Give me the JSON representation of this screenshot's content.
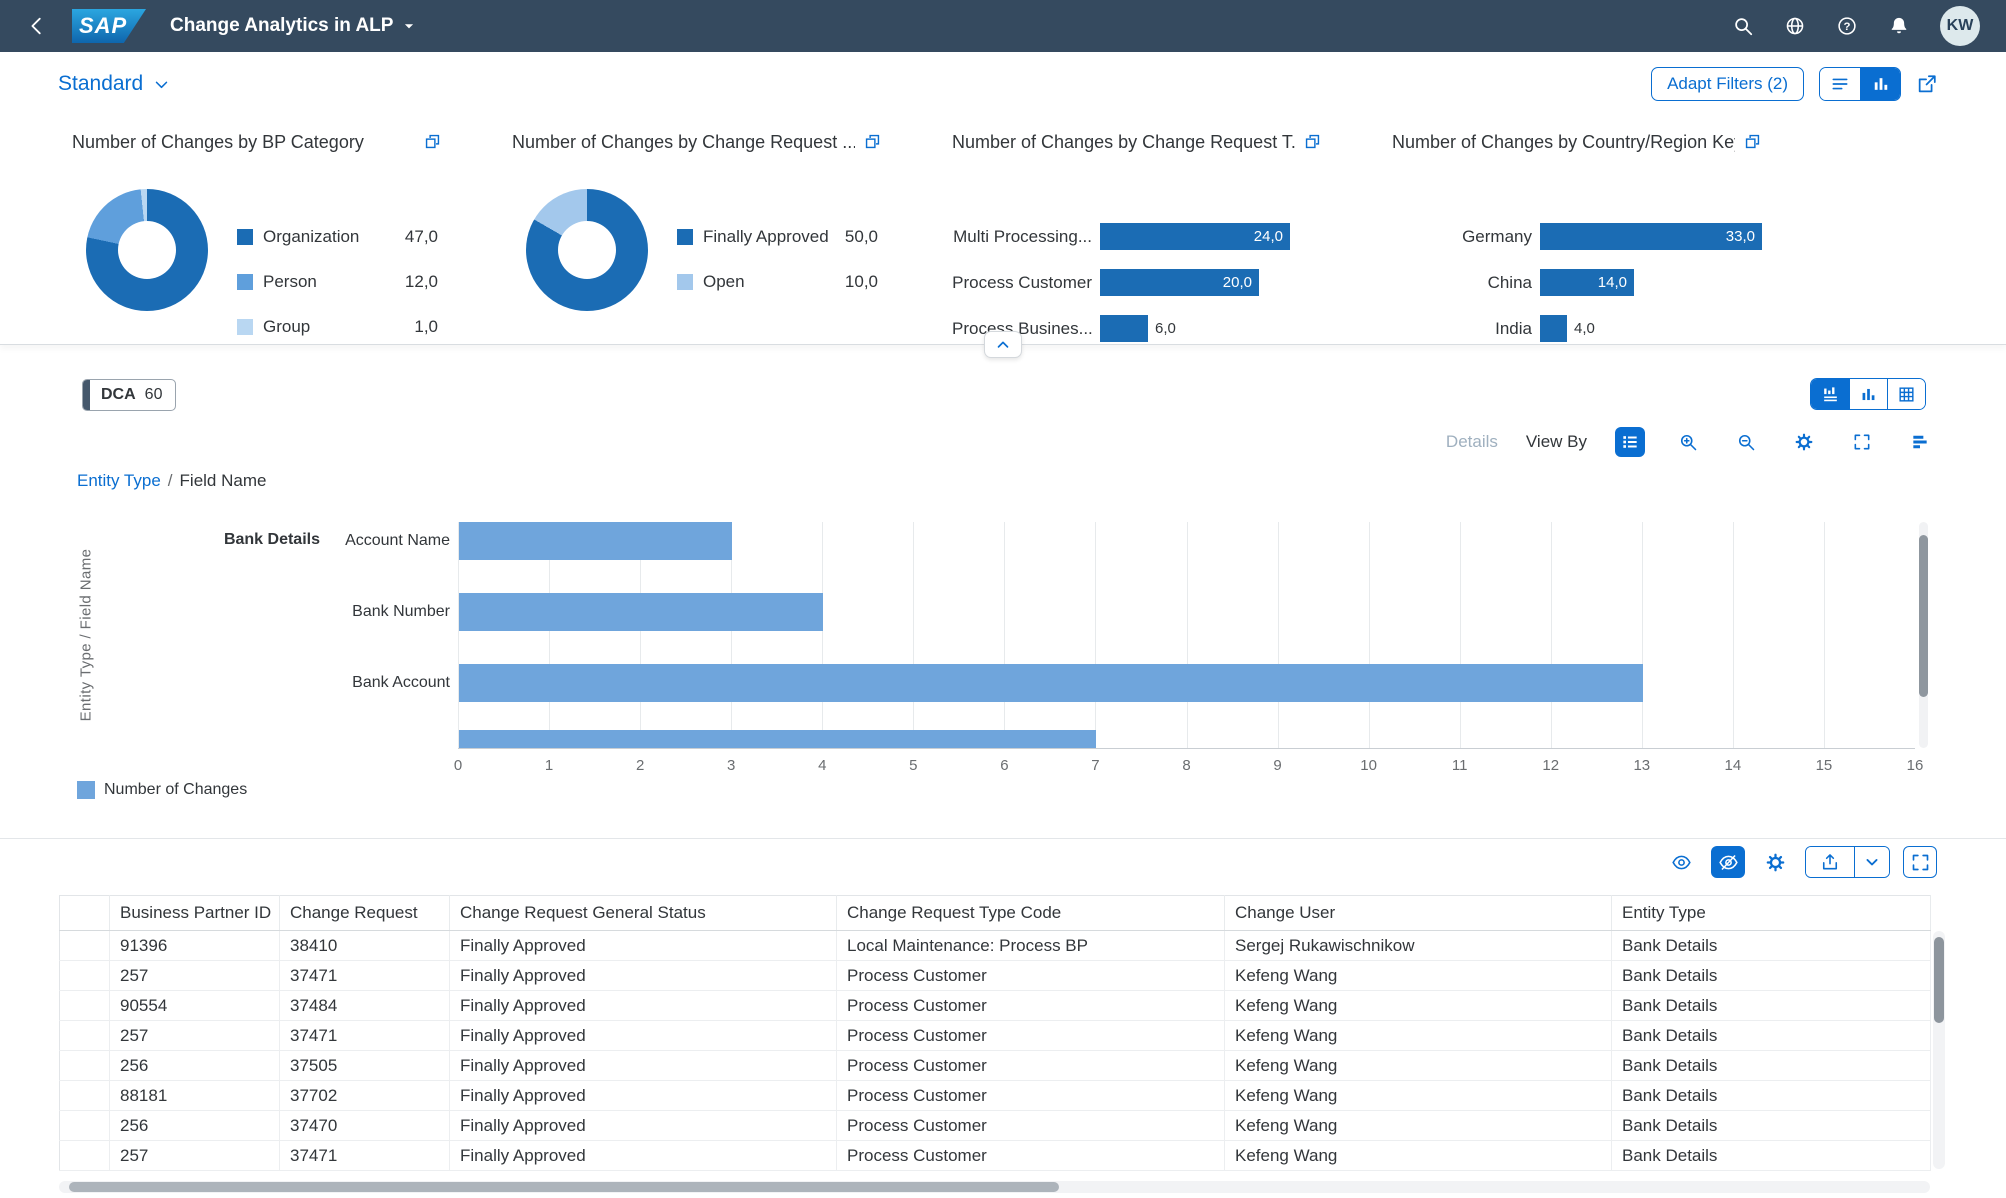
{
  "shell": {
    "logo_text": "SAP",
    "title": "Change Analytics in ALP",
    "avatar_initials": "KW",
    "icons": [
      "back-icon",
      "search-icon",
      "globe-icon",
      "help-icon",
      "bell-icon",
      "title-caret-icon"
    ]
  },
  "filter_bar": {
    "variant_name": "Standard",
    "adapt_filters_label": "Adapt Filters (2)",
    "view_toggle_icons": [
      "filter-list-icon",
      "filter-chart-icon"
    ],
    "share_icon": "share-icon",
    "accent_color": "#0a6ed1"
  },
  "kpis": [
    {
      "title": "Number of Changes by BP Category",
      "type": "donut",
      "items": [
        {
          "label": "Organization",
          "value": "47,0",
          "num": 47,
          "color": "#1b6cb4"
        },
        {
          "label": "Person",
          "value": "12,0",
          "num": 12,
          "color": "#5f9fdc"
        },
        {
          "label": "Group",
          "value": "1,0",
          "num": 1,
          "color": "#b9d7f2"
        }
      ]
    },
    {
      "title": "Number of Changes by Change Request ...",
      "type": "donut",
      "items": [
        {
          "label": "Finally Approved",
          "value": "50,0",
          "num": 50,
          "color": "#1b6cb4"
        },
        {
          "label": "Open",
          "value": "10,0",
          "num": 10,
          "color": "#a3c8ec"
        }
      ]
    },
    {
      "title": "Number of Changes by Change Request T...",
      "type": "bar",
      "axis_max": 28,
      "bar_color": "#1b6cb4",
      "items": [
        {
          "label": "Multi Processing...",
          "value": "24,0",
          "num": 24
        },
        {
          "label": "Process Customer",
          "value": "20,0",
          "num": 20
        },
        {
          "label": "Process Busines...",
          "value": "6,0",
          "num": 6
        }
      ]
    },
    {
      "title": "Number of Changes by Country/Region Key",
      "type": "bar",
      "axis_max": 33,
      "bar_color": "#1b6cb4",
      "items": [
        {
          "label": "Germany",
          "value": "33,0",
          "num": 33
        },
        {
          "label": "China",
          "value": "14,0",
          "num": 14
        },
        {
          "label": "India",
          "value": "4,0",
          "num": 4
        }
      ]
    }
  ],
  "content_header": {
    "kpi_tag": {
      "label": "DCA",
      "count": "60"
    },
    "view_switch_icons": [
      "hybrid-view-icon",
      "chart-view-icon",
      "table-view-icon"
    ],
    "chart_toolbar": {
      "details_label": "Details",
      "view_by_label": "View By",
      "icons": [
        "legend-icon",
        "zoom-in-icon",
        "zoom-out-icon",
        "settings-icon",
        "fullscreen-icon",
        "chart-type-icon"
      ]
    },
    "breadcrumb": {
      "link": "Entity Type",
      "separator": "/",
      "current": "Field Name"
    }
  },
  "chart_data": {
    "type": "bar",
    "orientation": "horizontal",
    "ylabel": "Entity Type / Field Name",
    "group_label": "Bank Details",
    "categories": [
      "Account Name",
      "Bank Number",
      "Bank Account"
    ],
    "values": [
      3,
      4,
      13
    ],
    "partial_next_bar_value": 7,
    "xlim": [
      0,
      16
    ],
    "x_ticks": [
      0,
      1,
      2,
      3,
      4,
      5,
      6,
      7,
      8,
      9,
      10,
      11,
      12,
      13,
      14,
      15,
      16
    ],
    "bar_color": "#6fa5dc",
    "grid": true,
    "legend": [
      {
        "label": "Number of Changes",
        "color": "#6fa5dc"
      }
    ]
  },
  "table_section": {
    "toolbar_icons": [
      "show-details-icon",
      "hide-details-icon",
      "settings-icon",
      "export-icon",
      "export-menu-caret-icon",
      "fullscreen-icon"
    ],
    "table": {
      "columns": [
        "Business Partner ID",
        "Change Request",
        "Change Request General Status",
        "Change Request Type Code",
        "Change User",
        "Entity Type"
      ],
      "rows": [
        [
          "91396",
          "38410",
          "Finally Approved",
          "Local Maintenance: Process BP",
          "Sergej Rukawischnikow",
          "Bank Details"
        ],
        [
          "257",
          "37471",
          "Finally Approved",
          "Process Customer",
          "Kefeng Wang",
          "Bank Details"
        ],
        [
          "90554",
          "37484",
          "Finally Approved",
          "Process Customer",
          "Kefeng Wang",
          "Bank Details"
        ],
        [
          "257",
          "37471",
          "Finally Approved",
          "Process Customer",
          "Kefeng Wang",
          "Bank Details"
        ],
        [
          "256",
          "37505",
          "Finally Approved",
          "Process Customer",
          "Kefeng Wang",
          "Bank Details"
        ],
        [
          "88181",
          "37702",
          "Finally Approved",
          "Process Customer",
          "Kefeng Wang",
          "Bank Details"
        ],
        [
          "256",
          "37470",
          "Finally Approved",
          "Process Customer",
          "Kefeng Wang",
          "Bank Details"
        ],
        [
          "257",
          "37471",
          "Finally Approved",
          "Process Customer",
          "Kefeng Wang",
          "Bank Details"
        ]
      ]
    }
  },
  "colors": {
    "shell_bg": "#354a5f",
    "accent": "#0a6ed1",
    "kpi_dark_blue": "#1b6cb4",
    "chart_bar_blue": "#6fa5dc"
  }
}
